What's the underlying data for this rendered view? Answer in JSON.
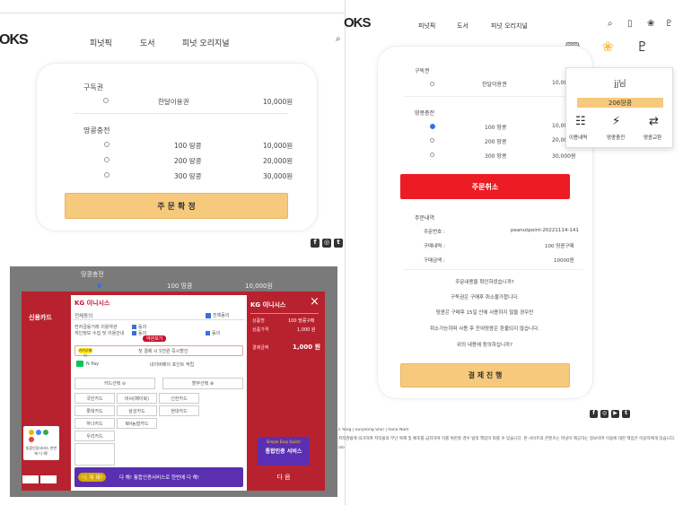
{
  "left": {
    "logo_text": "OKS",
    "nav": [
      "피넛픽",
      "도서",
      "피넛 오리지널"
    ],
    "subscription": {
      "title": "구독권",
      "items": [
        {
          "name": "한달이용권",
          "price": "10,000원"
        }
      ]
    },
    "charge": {
      "title": "땅콩충전",
      "items": [
        {
          "name": "100 땅콩",
          "price": "10,000원"
        },
        {
          "name": "200 땅콩",
          "price": "20,000원"
        },
        {
          "name": "300 땅콩",
          "price": "30,000원"
        }
      ]
    },
    "confirm_label": "주 문 확 정"
  },
  "payment": {
    "peek_title": "땅콩충전",
    "peek_item": "100 땅콩",
    "peek_price": "10,000원",
    "brand": "KG 이니시스",
    "brand_right": "KG 이니시스",
    "card_label": "신용카드",
    "terms_title": "전체동의",
    "terms_all": "전체동의",
    "terms_lines": [
      "전자금융거래 이용약관",
      "개인정보 수집 및 이용안내",
      "개인정보 제3자 제공 동의"
    ],
    "terms_checks": [
      "동의",
      "동의",
      "동의"
    ],
    "view_button": "약관보기",
    "kakaopay": "카카오페이",
    "kakaopay_desc": "첫 결제 시 5천원 즉시할인",
    "npay": "N Pay",
    "npay_desc": "네이버페이 포인트 적립",
    "card_select_left": "카드선택",
    "card_select_right": "할부선택",
    "card_grid": [
      "국민카드",
      "비씨(페이북)",
      "신한카드",
      "롯데카드",
      "삼성카드",
      "현대카드",
      "하나카드",
      "NH농협카드",
      "",
      "우리카드"
    ],
    "side_labels": [
      "상품명",
      "상품가격",
      "할인금액"
    ],
    "side_values": [
      "100 땅콩구매",
      "1,000 원",
      "1,000 원"
    ],
    "side_total_label": "결제금액",
    "side_total": "1,000 원",
    "banner_text": "Simple Easy Quick!",
    "banner_title": "통합인증 서비스",
    "bottom_banner": "다 해! 통합인증서비스로 한번에 다 해!",
    "bottom_left": "너, 뭐 돼?",
    "next_button": "다 음",
    "close": "×",
    "sidebar_promo": "통합인증서비스 한번에 다 해!"
  },
  "right": {
    "logo_text": "OKS",
    "nav": [
      "피넛픽",
      "도서",
      "피넛 오리지널"
    ],
    "subscription": {
      "title": "구독권",
      "items": [
        {
          "name": "한달이용권",
          "price": "10,00"
        }
      ]
    },
    "charge": {
      "title": "땅콩충전",
      "items": [
        {
          "name": "100 땅콩",
          "price": "10,00",
          "selected": true
        },
        {
          "name": "200 땅콩",
          "price": "20,00",
          "selected": false
        },
        {
          "name": "300 땅콩",
          "price": "30,000원",
          "selected": false
        }
      ]
    },
    "cancel_label": "주문취소",
    "order": {
      "title": "주문내역",
      "rows": [
        {
          "label": "주문번호 :",
          "value": "peanutpoint-20221114-141"
        },
        {
          "label": "구매내역 :",
          "value": "100 땅콩구매"
        },
        {
          "label": "구매금액 :",
          "value": "10000원"
        }
      ],
      "messages": [
        "주문내용을 확인하셨습니까?",
        "구독권은 구매후 취소불가합니다.",
        "땅콩은 구매후 15일 안에 사용하지 않을 경우만",
        "취소가능하며 사용 후 잔여땅콩은 환불되지 않습니다.",
        "위의 내용에 동의하십니까?"
      ]
    },
    "pay_label": "결 제 진 행",
    "popup": {
      "user": "jj님",
      "points": "206땅콩",
      "actions": [
        "이용내역",
        "땅콩충전",
        "땅콩교환"
      ]
    },
    "footer_lines": [
      "s Yang | eunjeong Shin | hana Nam",
      "저작권법에 의거하여 저작물의 무단 복제 및 배포를 금지하며 이를 위반할 경우 법적 책임이 따를 수 있습니다. 본 사이트의 콘텐츠는 피넛이 제공하는 정보이며 이용에 대한 책임은 이용자에게 있습니다.",
      "olo"
    ]
  },
  "colors": {
    "accent": "#f7c97c",
    "red": "#ed1c24",
    "kg_red": "#b8222e"
  }
}
